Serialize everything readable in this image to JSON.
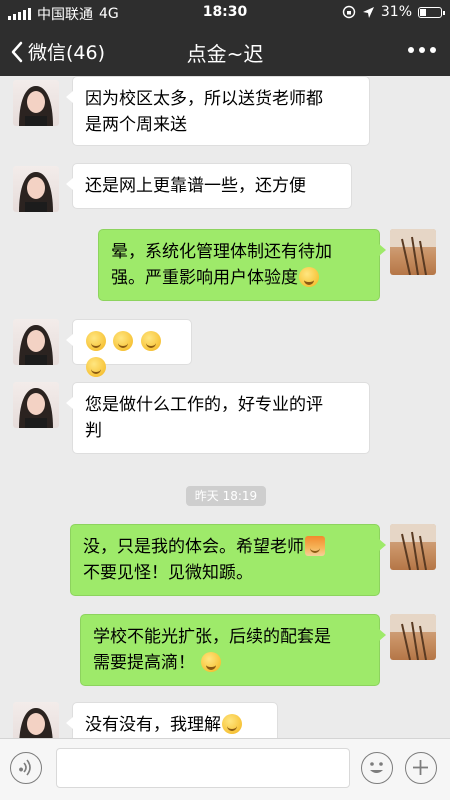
{
  "status_bar": {
    "carrier": "中国联通",
    "network": "4G",
    "time": "18:30",
    "battery": "31%",
    "battery_level": 0.31
  },
  "nav": {
    "back_label": "微信(46)",
    "title": "点金~迟",
    "more_icon": "ellipsis-icon"
  },
  "messages": [
    {
      "side": "left",
      "lines": [
        "因为校区太多，所以送货老师都",
        "是两个周来送"
      ]
    },
    {
      "side": "left",
      "lines": [
        "还是网上更靠谱一些，还方便"
      ]
    },
    {
      "side": "right",
      "lines": [
        "晕，系统化管理体制还有待加",
        "强。严重影响用户体验度"
      ],
      "emoji": "laugh-emoji"
    },
    {
      "side": "left",
      "emojis": [
        "thinking-emoji",
        "smile-emoji",
        "thinking-emoji",
        "thinking-emoji"
      ]
    },
    {
      "side": "left",
      "lines": [
        "您是做什么工作的，好专业的评",
        "判"
      ]
    },
    {
      "side": "right",
      "lines": [
        "没，只是我的体会。希望老师",
        "不要见怪！见微知踬。"
      ],
      "emoji": "teacher-emoji"
    },
    {
      "side": "right",
      "lines": [
        "学校不能光扩张，后续的配套是",
        "需要提高滴！"
      ],
      "emoji": "laugh-emoji"
    },
    {
      "side": "left",
      "lines": [
        "没有没有，我理解"
      ],
      "emoji": "thinking-emoji"
    }
  ],
  "timestamp": "昨天 18:19",
  "input_bar": {
    "voice_icon": "voice-icon",
    "emoji_icon": "emoji-face-icon",
    "plus_icon": "plus-icon",
    "input_value": ""
  }
}
